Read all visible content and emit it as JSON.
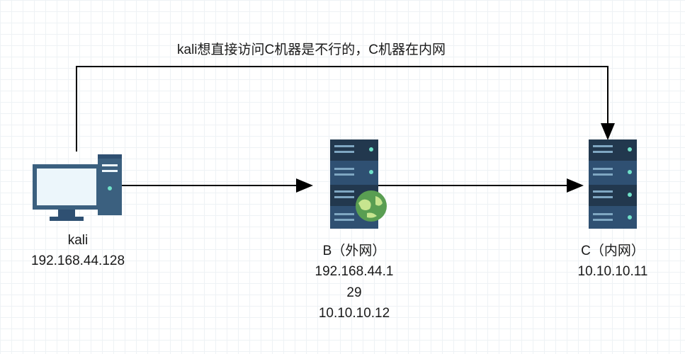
{
  "caption": "kali想直接访问C机器是不行的，C机器在内网",
  "nodes": {
    "kali": {
      "name": "kali",
      "ip": "192.168.44.128"
    },
    "b": {
      "name": "B（外网）",
      "ip_line1": "192.168.44.1",
      "ip_line2": "29",
      "ip_line3": "10.10.10.12"
    },
    "c": {
      "name": "C（内网）",
      "ip": "10.10.10.11"
    }
  },
  "connections": [
    {
      "from": "kali",
      "to": "B",
      "type": "direct"
    },
    {
      "from": "B",
      "to": "C",
      "type": "direct"
    },
    {
      "from": "kali",
      "to": "C",
      "type": "blocked_topline"
    }
  ],
  "colors": {
    "server_body": "#2f5072",
    "server_dark": "#22384e",
    "monitor_frame": "#3b607f",
    "monitor_screen": "#ecf6fb",
    "globe": "#599e52",
    "arrow": "#000000"
  }
}
